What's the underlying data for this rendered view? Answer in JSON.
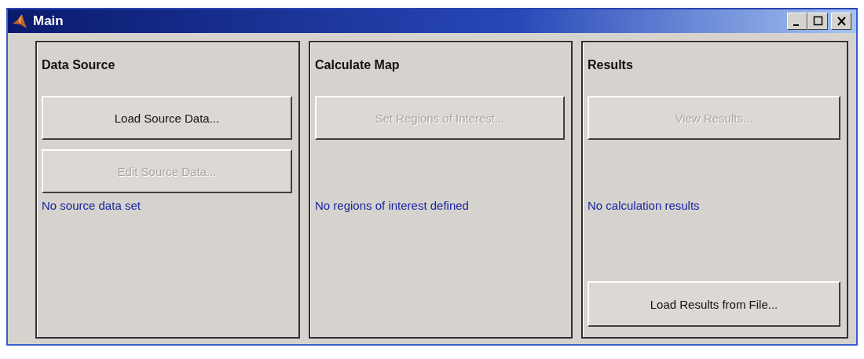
{
  "window": {
    "title": "Main"
  },
  "panels": [
    {
      "title": "Data Source",
      "buttons": [
        {
          "label": "Load Source Data...",
          "disabled": false
        },
        {
          "label": "Edit Source Data...",
          "disabled": true
        }
      ],
      "status": "No source data set"
    },
    {
      "title": "Calculate Map",
      "buttons": [
        {
          "label": "Set Regions of Interest...",
          "disabled": true
        }
      ],
      "status": "No regions of interest defined"
    },
    {
      "title": "Results",
      "buttons": [
        {
          "label": "View Results...",
          "disabled": true
        }
      ],
      "status": "No calculation results",
      "footer_button": {
        "label": "Load Results from File...",
        "disabled": false
      }
    }
  ]
}
